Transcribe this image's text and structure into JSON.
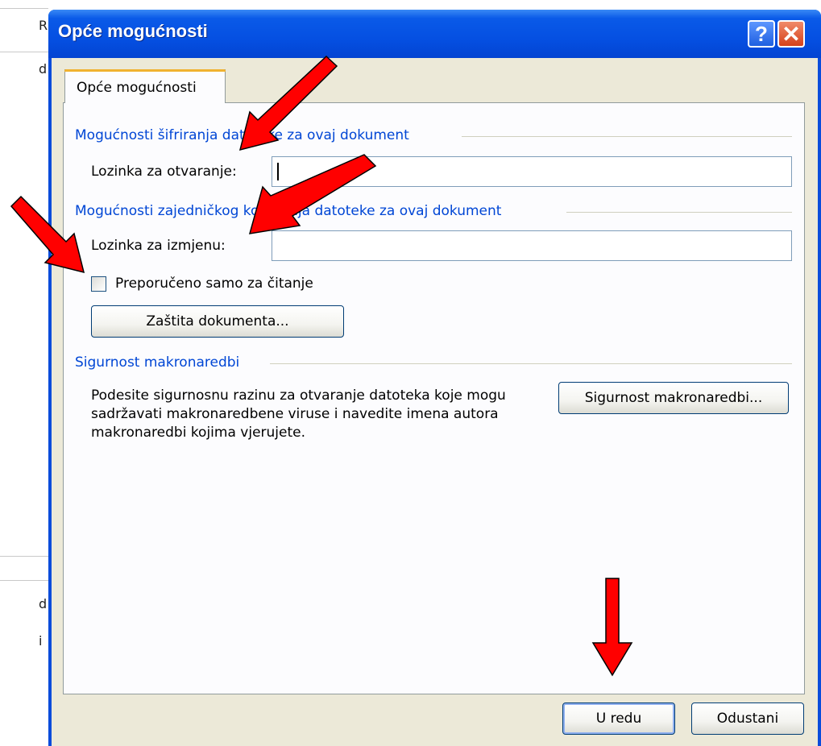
{
  "background_fragments": [
    "R",
    "d",
    "d",
    "i"
  ],
  "window": {
    "title": "Opće mogućnosti",
    "help_glyph": "?",
    "close_glyph": "✕"
  },
  "tab": {
    "label": "Opće mogućnosti"
  },
  "encryption": {
    "group_title": "Mogućnosti šifriranja datoteke za ovaj dokument",
    "open_password_label": "Lozinka za otvaranje:",
    "open_password_value": ""
  },
  "sharing": {
    "group_title": "Mogućnosti zajedničkog korištenja datoteke za ovaj dokument",
    "modify_password_label": "Lozinka za izmjenu:",
    "modify_password_value": "",
    "readonly_label": "Preporučeno samo za čitanje",
    "readonly_checked": false,
    "protect_button": "Zaštita dokumenta..."
  },
  "macro": {
    "group_title": "Sigurnost makronaredbi",
    "description": "Podesite sigurnosnu razinu za otvaranje datoteka koje mogu sadržavati makronaredbene viruse i navedite imena autora makronaredbi kojima vjerujete.",
    "button": "Sigurnost makronaredbi..."
  },
  "footer": {
    "ok_button": "U redu",
    "cancel_button": "Odustani"
  },
  "colors": {
    "titlebar": "#0550e2",
    "group_title": "#0046d5",
    "annotation_arrow": "#ff0000"
  }
}
